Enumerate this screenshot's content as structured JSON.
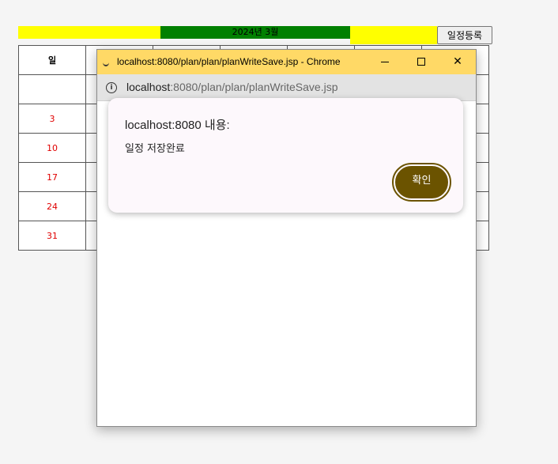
{
  "calendar": {
    "month_title": "2024년 3월",
    "add_button": "일정등록",
    "sunday_header": "일",
    "sunday_dates": [
      "",
      "3",
      "10",
      "17",
      "24",
      "31"
    ],
    "colors": {
      "header_yellow": "#ffff00",
      "header_green": "#008000",
      "sunday_red": "#e00000"
    }
  },
  "popup_window": {
    "title": "localhost:8080/plan/plan/planWriteSave.jsp - Chrome",
    "address_host": "localhost",
    "address_path": ":8080/plan/plan/planWriteSave.jsp",
    "titlebar_color": "#ffd966"
  },
  "alert": {
    "title": "localhost:8080 내용:",
    "message": "일정 저장완료",
    "ok_label": "확인",
    "ok_color": "#6b5300"
  }
}
